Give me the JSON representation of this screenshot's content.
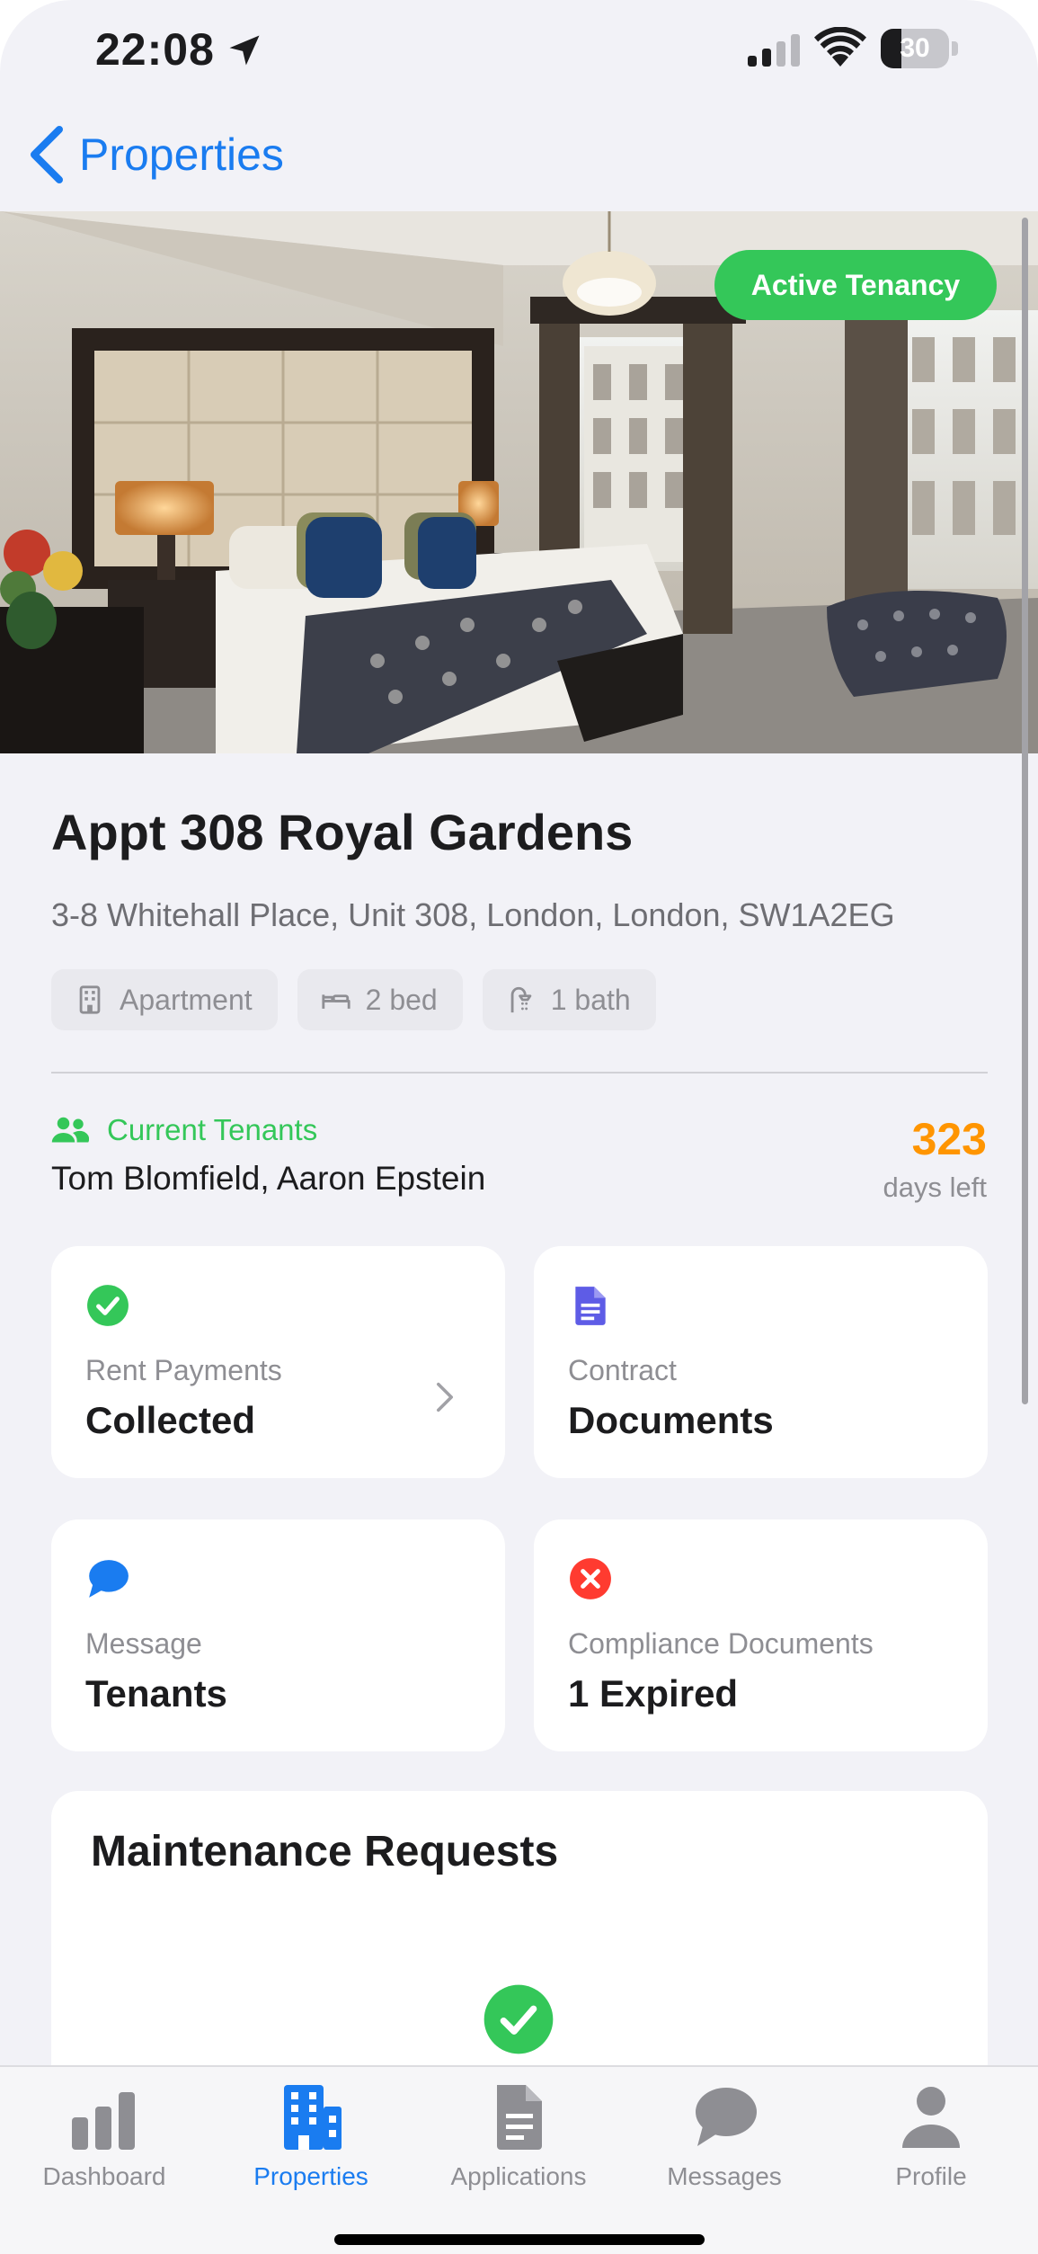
{
  "status_bar": {
    "time": "22:08",
    "battery_level": "30"
  },
  "nav": {
    "back_label": "Properties"
  },
  "property": {
    "status_badge": "Active Tenancy",
    "title": "Appt 308 Royal Gardens",
    "address": "3-8 Whitehall Place, Unit 308, London, London, SW1A2EG",
    "chips": [
      {
        "icon": "building-icon",
        "label": "Apartment"
      },
      {
        "icon": "bed-icon",
        "label": "2 bed"
      },
      {
        "icon": "shower-icon",
        "label": "1 bath"
      }
    ]
  },
  "tenants": {
    "label": "Current Tenants",
    "names": "Tom Blomfield, Aaron Epstein",
    "days_left_value": "323",
    "days_left_label": "days left"
  },
  "cards": [
    {
      "icon": "check-circle-icon",
      "label": "Rent Payments",
      "value": "Collected"
    },
    {
      "icon": "document-icon",
      "label": "Contract",
      "value": "Documents"
    },
    {
      "icon": "message-bubble-icon",
      "label": "Message",
      "value": "Tenants"
    },
    {
      "icon": "x-circle-icon",
      "label": "Compliance Documents",
      "value": "1 Expired"
    }
  ],
  "maintenance": {
    "title": "Maintenance Requests"
  },
  "tabbar": {
    "active": "Properties",
    "tabs": [
      {
        "icon": "chart-icon",
        "label": "Dashboard"
      },
      {
        "icon": "building-icon",
        "label": "Properties"
      },
      {
        "icon": "document-icon",
        "label": "Applications"
      },
      {
        "icon": "chat-icon",
        "label": "Messages"
      },
      {
        "icon": "person-icon",
        "label": "Profile"
      }
    ]
  },
  "colors": {
    "accent_blue": "#1a7cf0",
    "green": "#34c759",
    "orange": "#ff9500",
    "red": "#ff3b30",
    "purple": "#5e5ce6",
    "background": "#f2f2f7"
  }
}
